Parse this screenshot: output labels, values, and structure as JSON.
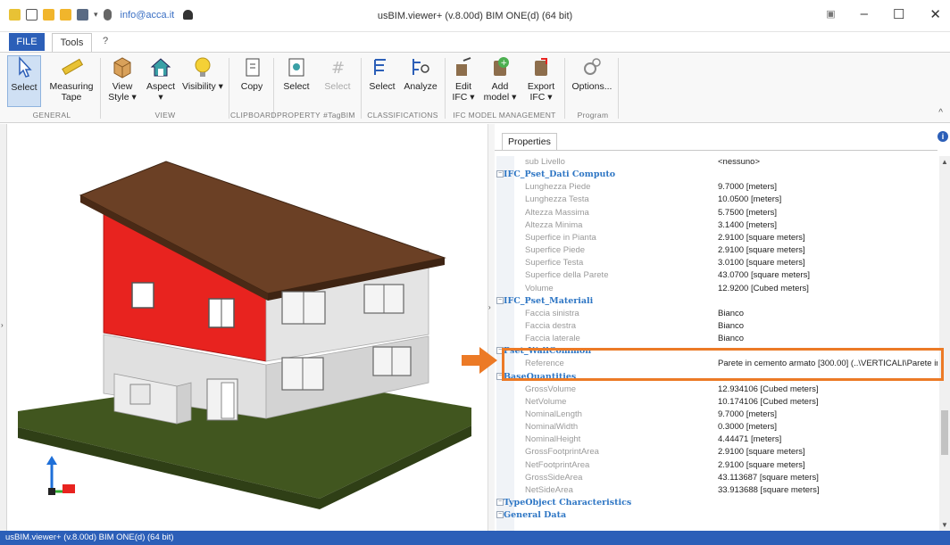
{
  "app": {
    "title": "usBIM.viewer+ (v.8.00d) BIM ONE(d) (64 bit)",
    "email": "info@acca.it",
    "status": "usBIM.viewer+ (v.8.00d) BIM ONE(d) (64 bit)"
  },
  "window_controls": {
    "minimize": "–",
    "maximize": "☐",
    "close": "✕",
    "restore": "▣"
  },
  "ribbon_tabs": {
    "file": "FILE",
    "tools": "Tools",
    "help": "?"
  },
  "ribbon": {
    "select": "Select",
    "measuring": "Measuring Tape",
    "view_style": "View Style ▾",
    "aspect": "Aspect ▾",
    "visibility": "Visibility ▾",
    "copy": "Copy",
    "prop_select": "Select",
    "tag_select": "Select",
    "class_select": "Select",
    "analyze": "Analyze",
    "edit_ifc": "Edit IFC ▾",
    "add_model": "Add model ▾",
    "export_ifc": "Export IFC ▾",
    "options": "Options...",
    "collapse": "^",
    "groups": {
      "general": "GENERAL",
      "view": "VIEW",
      "clipboard": "CLIPBOARD",
      "property": "PROPERTY",
      "tagbim": "#TagBIM",
      "classifications": "CLASSIFICATIONS",
      "ifc_model": "IFC MODEL MANAGEMENT",
      "program": "Program"
    }
  },
  "properties": {
    "tab": "Properties",
    "rows": [
      {
        "type": "prop",
        "key": "sub Livello",
        "value": "<nessuno>"
      },
      {
        "type": "cat",
        "key": "IFC_Pset_Dati Computo"
      },
      {
        "type": "prop",
        "key": "Lunghezza Piede",
        "value": "9.7000 [meters]"
      },
      {
        "type": "prop",
        "key": "Lunghezza Testa",
        "value": "10.0500 [meters]"
      },
      {
        "type": "prop",
        "key": "Altezza Massima",
        "value": "5.7500 [meters]"
      },
      {
        "type": "prop",
        "key": "Altezza Minima",
        "value": "3.1400 [meters]"
      },
      {
        "type": "prop",
        "key": "Superfice in Pianta",
        "value": "2.9100 [square meters]"
      },
      {
        "type": "prop",
        "key": "Superfice Piede",
        "value": "2.9100 [square meters]"
      },
      {
        "type": "prop",
        "key": "Superfice Testa",
        "value": "3.0100 [square meters]"
      },
      {
        "type": "prop",
        "key": "Superfice della Parete",
        "value": "43.0700 [square meters]"
      },
      {
        "type": "prop",
        "key": "Volume",
        "value": "12.9200 [Cubed meters]"
      },
      {
        "type": "cat",
        "key": "IFC_Pset_Materiali"
      },
      {
        "type": "prop",
        "key": "Faccia sinistra",
        "value": "Bianco"
      },
      {
        "type": "prop",
        "key": "Faccia destra",
        "value": "Bianco"
      },
      {
        "type": "prop",
        "key": "Faccia laterale",
        "value": "Bianco"
      },
      {
        "type": "cat",
        "key": "Pset_WallCommon"
      },
      {
        "type": "prop",
        "key": "Reference",
        "value": "Parete in cemento armato [300.00]   (..\\VERTICALI\\Parete in c"
      },
      {
        "type": "cat",
        "key": "BaseQuantities"
      },
      {
        "type": "prop",
        "key": "GrossVolume",
        "value": "12.934106 [Cubed meters]"
      },
      {
        "type": "prop",
        "key": "NetVolume",
        "value": "10.174106 [Cubed meters]"
      },
      {
        "type": "prop",
        "key": "NominalLength",
        "value": "9.7000 [meters]"
      },
      {
        "type": "prop",
        "key": "NominalWidth",
        "value": "0.3000 [meters]"
      },
      {
        "type": "prop",
        "key": "NominalHeight",
        "value": "4.44471 [meters]"
      },
      {
        "type": "prop",
        "key": "GrossFootprintArea",
        "value": "2.9100 [square meters]"
      },
      {
        "type": "prop",
        "key": "NetFootprintArea",
        "value": "2.9100 [square meters]"
      },
      {
        "type": "prop",
        "key": "GrossSideArea",
        "value": "43.113687 [square meters]"
      },
      {
        "type": "prop",
        "key": "NetSideArea",
        "value": "33.913688 [square meters]"
      },
      {
        "type": "cat",
        "key": "TypeObject Characteristics"
      },
      {
        "type": "cat",
        "key": "General Data"
      }
    ]
  },
  "colors": {
    "accent": "#2c5fb8",
    "highlight": "#ec7a26",
    "wall_selected": "#e8231f",
    "roof": "#6b4025",
    "grass": "#3d5220"
  }
}
